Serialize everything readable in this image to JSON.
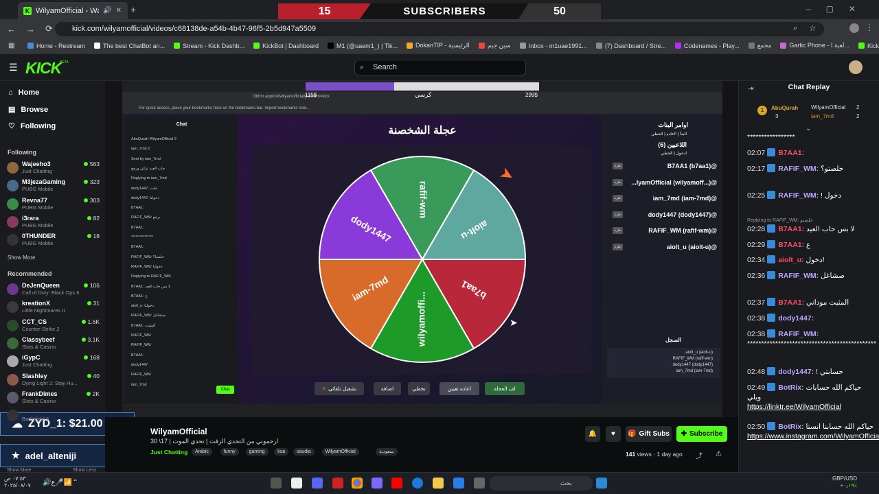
{
  "browser": {
    "tab_title": "WilyamOfficial - Watch the",
    "url": "kick.com/wilyamofficial/videos/c68138de-a54b-4b47-96f5-2b5d947a5509",
    "bookmarks": [
      "Home - Restream",
      "The best ChatBot an...",
      "Stream - Kick Dashb...",
      "KickBot | Dashboard",
      "M1 (@uaem1_) | Tik...",
      "DokanTIP - الرئيسية",
      "سين جيم",
      "Inbox - m1uae1991...",
      "(7) Dashboard / Stre...",
      "Codenames - Play...",
      "مجمع",
      "Gartic Phone - لعبة ا...",
      "KickBot | #1 Kick Vie..."
    ]
  },
  "subscriber_bar": {
    "left_count": "15",
    "label": "SUBSCRIBERS",
    "right_count": "50"
  },
  "kick": {
    "logo": "KICK",
    "beta": "BETA",
    "search_placeholder": "Search"
  },
  "sidebar": {
    "nav": [
      "Home",
      "Browse",
      "Following"
    ],
    "following_title": "Following",
    "following": [
      {
        "name": "Wajeeho3",
        "sub": "Just Chatting",
        "viewers": "563",
        "color": "#8a6a3a"
      },
      {
        "name": "M3jezaGaming",
        "sub": "PUBG Mobile",
        "viewers": "323",
        "color": "#4a6a8a"
      },
      {
        "name": "Revna77",
        "sub": "PUBG Mobile",
        "viewers": "303",
        "color": "#3a8a4a"
      },
      {
        "name": "i3rara",
        "sub": "PUBG Mobile",
        "viewers": "82",
        "color": "#8a3a5a"
      },
      {
        "name": "0THUNDER",
        "sub": "PUBG Mobile",
        "viewers": "18",
        "color": "#333333"
      }
    ],
    "show_more": "Show More",
    "recommended_title": "Recommended",
    "recommended": [
      {
        "name": "DeJenQueen",
        "sub": "Call of Duty: Black Ops 6",
        "viewers": "106",
        "color": "#6a3a8a"
      },
      {
        "name": "kreationX",
        "sub": "Little Nightmares II",
        "viewers": "31",
        "color": "#3a3a3a"
      },
      {
        "name": "CCT_CS",
        "sub": "Counter-Strike 2",
        "viewers": "1.6K",
        "color": "#2a4a2a"
      },
      {
        "name": "Classybeef",
        "sub": "Slots & Casino",
        "viewers": "3.1K",
        "color": "#3a6a3a"
      },
      {
        "name": "iGypC",
        "sub": "Just Chatting",
        "viewers": "168",
        "color": "#aaaaaa"
      },
      {
        "name": "Slashley",
        "sub": "Dying Light 2: Stay Hu...",
        "viewers": "40",
        "color": "#8a5a4a"
      },
      {
        "name": "FrankDimes",
        "sub": "Slots & Casino",
        "viewers": "2K",
        "color": "#5a5a6a"
      },
      {
        "name": "",
        "sub": "Battlefield 6",
        "viewers": "",
        "color": "#333333"
      }
    ],
    "footer_show_more": "Show More",
    "footer_show_less": "Show Less"
  },
  "overlays": {
    "donation": "ZYD_1: $21.00",
    "follower": "adel_alteniji"
  },
  "embedded": {
    "price_left": "115$",
    "price_right": "299$",
    "price_mid": "كرسي",
    "progress_fraction": 0.38,
    "inner_url": "l3bhm.app/roll/wilyamofficial/platform=kick",
    "bookmark_hint": "For quick access, place your bookmarks here on the bookmarks bar. Import bookmarks now...",
    "chat_title": "Chat",
    "chat_lines": [
      "AbuQurah  WilyamOfficial 2",
      "iam_7md 2",
      "Sent by  iam_7md",
      "جاب العيد ثرائي ورجع",
      "Replying to iam_7md",
      "dody1447: خلت",
      "dody1447: دخولنا",
      "B7AA1:",
      "RAFIF_WM: برجع",
      "B7AA1:",
      "***************",
      "B7AA1:",
      "RAFIF_WM: خلصنا؟",
      "RAFIF_WM: دخولنا",
      "Replying to RAFIF_WM",
      "B7AA1: لا بس حاب العيد",
      "B7AA1: ح",
      "aiolt_u: دخولنا",
      "RAFIF_WM: صشاغل",
      "B7AA1: المثبت",
      "RAFIF_WM",
      "RAFIF_WM",
      "B7AA1:",
      "dody1447",
      "RAFIF_WM",
      "iam_7md"
    ],
    "game_title": "عجلة الشخصنة",
    "wheel": [
      {
        "label": "rafif-wm",
        "color": "#3a9a5a"
      },
      {
        "label": "aiolt-u",
        "color": "#5fa8a0"
      },
      {
        "label": "b7aa1",
        "color": "#b8283a"
      },
      {
        "label": "wilyamoffi...",
        "color": "#1e9a28"
      },
      {
        "label": "iam-7md",
        "color": "#d86a2a"
      },
      {
        "label": "dody1447",
        "color": "#8a3ad8"
      }
    ],
    "buttons": [
      "تشغيل تلقائي",
      "اضافه",
      "تخطي",
      "اعاده تعيين",
      "لف العجلة"
    ],
    "commands_title": "اوامر البنات",
    "commands_sub": "البدأ | !اعاده | الخطي",
    "players_title": "اللاعبين (6)",
    "players_sub": "ادخول | الخطي",
    "players": [
      "B7AA1 (b7aa1)@",
      "...lyamOfficial (wilyamoff...)@",
      "iam_7md (iam-7md)@",
      "dody1447 (dody1447)@",
      "RAFIF_WM (rafif-wm)@",
      "aiolt_u (aiolt-u)@"
    ],
    "player_btn": "طرد",
    "log_title": "السجل",
    "log": [
      "aiolt_u (aiolt-u)",
      "RAFIF_WM (rafif-wm)",
      "dody1447 (dody1447)",
      "iam_7md (iam-7md)"
    ],
    "chat_btn": "Chat"
  },
  "stream": {
    "channel": "WilyamOfficial",
    "title": "ارحموني من التحدي الزفت | تحدي الموت | 17\\ 30",
    "category": "Just Chatting",
    "tags": [
      "Arabic",
      "funny",
      "gaming",
      "ksa",
      "saudia",
      "WilyamOfficial",
      "سعودية"
    ],
    "views": "141",
    "views_label": "views",
    "age": "1 day ago",
    "gift_subs": "Gift Subs",
    "subscribe": "Subscribe"
  },
  "chat": {
    "title": "Chat Replay",
    "pinned_user": "AbuQurah",
    "pinned_count": "3",
    "pinned_other": "WilyamOfficial",
    "pinned_other_count": "2",
    "pinned_third": "iam_7md",
    "pinned_third_count": "2",
    "messages": [
      {
        "time": "",
        "user": "",
        "ucolor": "#ffffff",
        "text": "*****************"
      },
      {
        "time": "02:07",
        "user": "B7AA1:",
        "ucolor": "#ff4d6a",
        "text": ""
      },
      {
        "time": "02:17",
        "user": "RAFIF_WM:",
        "ucolor": "#b9a7ff",
        "text": "خلصتو؟"
      },
      {
        "time": "02:25",
        "user": "RAFIF_WM:",
        "ucolor": "#b9a7ff",
        "text": "! دخول"
      },
      {
        "time": "02:28",
        "user": "B7AA1:",
        "ucolor": "#ff4d6a",
        "text": "لا بس حاب العيد",
        "reply": "Replying to RAFIF_WM: خلصنو"
      },
      {
        "time": "02:29",
        "user": "B7AA1:",
        "ucolor": "#ff4d6a",
        "text": "ع"
      },
      {
        "time": "02:34",
        "user": "aiolt_u:",
        "ucolor": "#ff4d6a",
        "text": "دخول!"
      },
      {
        "time": "02:36",
        "user": "RAFIF_WM:",
        "ucolor": "#b9a7ff",
        "text": "صشاغل"
      },
      {
        "time": "02:37",
        "user": "B7AA1:",
        "ucolor": "#ff4d6a",
        "text": "المثبت موداني"
      },
      {
        "time": "02:38",
        "user": "dody1447:",
        "ucolor": "#b9a7ff",
        "text": ""
      },
      {
        "time": "02:38",
        "user": "RAFIF_WM:",
        "ucolor": "#b9a7ff",
        "text": "**********************************************"
      },
      {
        "time": "02:48",
        "user": "dody1447:",
        "ucolor": "#b9a7ff",
        "text": "! حسابتي"
      },
      {
        "time": "02:49",
        "user": "BotRix:",
        "ucolor": "#b9a7ff",
        "text": "حياكم الله حسابات ويلي",
        "link": "https://linktr.ee/WilyamOfficial"
      },
      {
        "time": "02:50",
        "user": "BotRix:",
        "ucolor": "#b9a7ff",
        "text": "حياكم الله حسابنا انستا",
        "link": "https://www.instagram.com/WilyamOfficial"
      }
    ]
  },
  "taskbar": {
    "search": "بحث",
    "date_left": "٢٠٢٥/٠٨/٠٧",
    "time_left": "٠٧:٥٣ ص",
    "fx": "GBP/USD",
    "fx_change": "+٠٫١٩٪"
  }
}
